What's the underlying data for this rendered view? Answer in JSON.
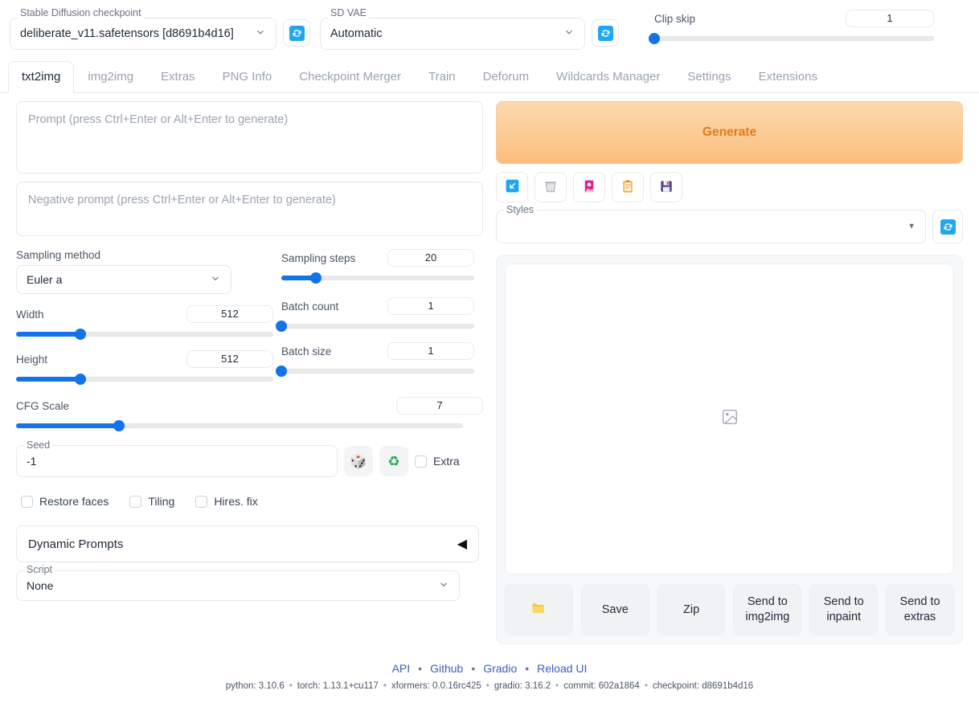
{
  "topbar": {
    "checkpoint": {
      "legend": "Stable Diffusion checkpoint",
      "value": "deliberate_v11.safetensors [d8691b4d16]",
      "caret": "chevron-down"
    },
    "checkpoint_refresh_icon": "refresh-icon",
    "vae": {
      "legend": "SD VAE",
      "value": "Automatic",
      "caret": "chevron-down"
    },
    "vae_refresh_icon": "refresh-icon",
    "clip_skip": {
      "label": "Clip skip",
      "value": "1",
      "percent": 0
    }
  },
  "tabs": [
    {
      "label": "txt2img",
      "active": true
    },
    {
      "label": "img2img",
      "active": false
    },
    {
      "label": "Extras",
      "active": false
    },
    {
      "label": "PNG Info",
      "active": false
    },
    {
      "label": "Checkpoint Merger",
      "active": false
    },
    {
      "label": "Train",
      "active": false
    },
    {
      "label": "Deforum",
      "active": false
    },
    {
      "label": "Wildcards Manager",
      "active": false
    },
    {
      "label": "Settings",
      "active": false
    },
    {
      "label": "Extensions",
      "active": false
    }
  ],
  "prompt": {
    "placeholder": "Prompt (press Ctrl+Enter or Alt+Enter to generate)",
    "value": ""
  },
  "negative_prompt": {
    "placeholder": "Negative prompt (press Ctrl+Enter or Alt+Enter to generate)",
    "value": ""
  },
  "generate": {
    "label": "Generate",
    "color": "#e07b1e"
  },
  "tool_icons": [
    {
      "name": "restore-progress-icon",
      "glyph": "↙"
    },
    {
      "name": "clear-prompt-trash-icon",
      "glyph": "🗑"
    },
    {
      "name": "show-extra-networks-icon",
      "glyph": "🎴"
    },
    {
      "name": "apply-style-clipboard-icon",
      "glyph": "📋"
    },
    {
      "name": "save-style-floppy-icon",
      "glyph": "💾"
    }
  ],
  "styles": {
    "legend": "Styles",
    "value": "",
    "refresh_icon": "refresh-icon"
  },
  "params": {
    "sampling_method": {
      "label": "Sampling method",
      "value": "Euler a"
    },
    "sampling_steps": {
      "label": "Sampling steps",
      "value": "20",
      "percent": 18
    },
    "width": {
      "label": "Width",
      "value": "512",
      "percent": 25
    },
    "height": {
      "label": "Height",
      "value": "512",
      "percent": 25
    },
    "cfg_scale": {
      "label": "CFG Scale",
      "value": "7",
      "percent": 23
    },
    "batch_count": {
      "label": "Batch count",
      "value": "1",
      "percent": 0
    },
    "batch_size": {
      "label": "Batch size",
      "value": "1",
      "percent": 0
    }
  },
  "seed": {
    "legend": "Seed",
    "value": "-1",
    "dice_icon": "🎲",
    "recycle_icon": "♻",
    "extra_label": "Extra",
    "extra_checked": false
  },
  "checkboxes": [
    {
      "label": "Restore faces",
      "checked": false
    },
    {
      "label": "Tiling",
      "checked": false
    },
    {
      "label": "Hires. fix",
      "checked": false
    }
  ],
  "dynamic_prompts": {
    "title": "Dynamic Prompts",
    "arrow": "◀"
  },
  "script": {
    "legend": "Script",
    "value": "None"
  },
  "output": {
    "placeholder_icon": "image-placeholder-icon",
    "buttons": [
      {
        "name": "open-folder-button",
        "label": "📂",
        "icon_only": true
      },
      {
        "name": "save-button",
        "label": "Save",
        "icon_only": false
      },
      {
        "name": "zip-button",
        "label": "Zip",
        "icon_only": false
      },
      {
        "name": "send-to-img2img-button",
        "label": "Send to\nimg2img",
        "icon_only": false
      },
      {
        "name": "send-to-inpaint-button",
        "label": "Send to\ninpaint",
        "icon_only": false
      },
      {
        "name": "send-to-extras-button",
        "label": "Send to\nextras",
        "icon_only": false
      }
    ]
  },
  "footer": {
    "links": [
      "API",
      "Github",
      "Gradio",
      "Reload UI"
    ],
    "separator": "•",
    "versions": [
      "python: 3.10.6",
      "torch: 1.13.1+cu117",
      "xformers: 0.0.16rc425",
      "gradio: 3.16.2",
      "commit: 602a1864",
      "checkpoint: d8691b4d16"
    ],
    "version_separator": "•"
  }
}
